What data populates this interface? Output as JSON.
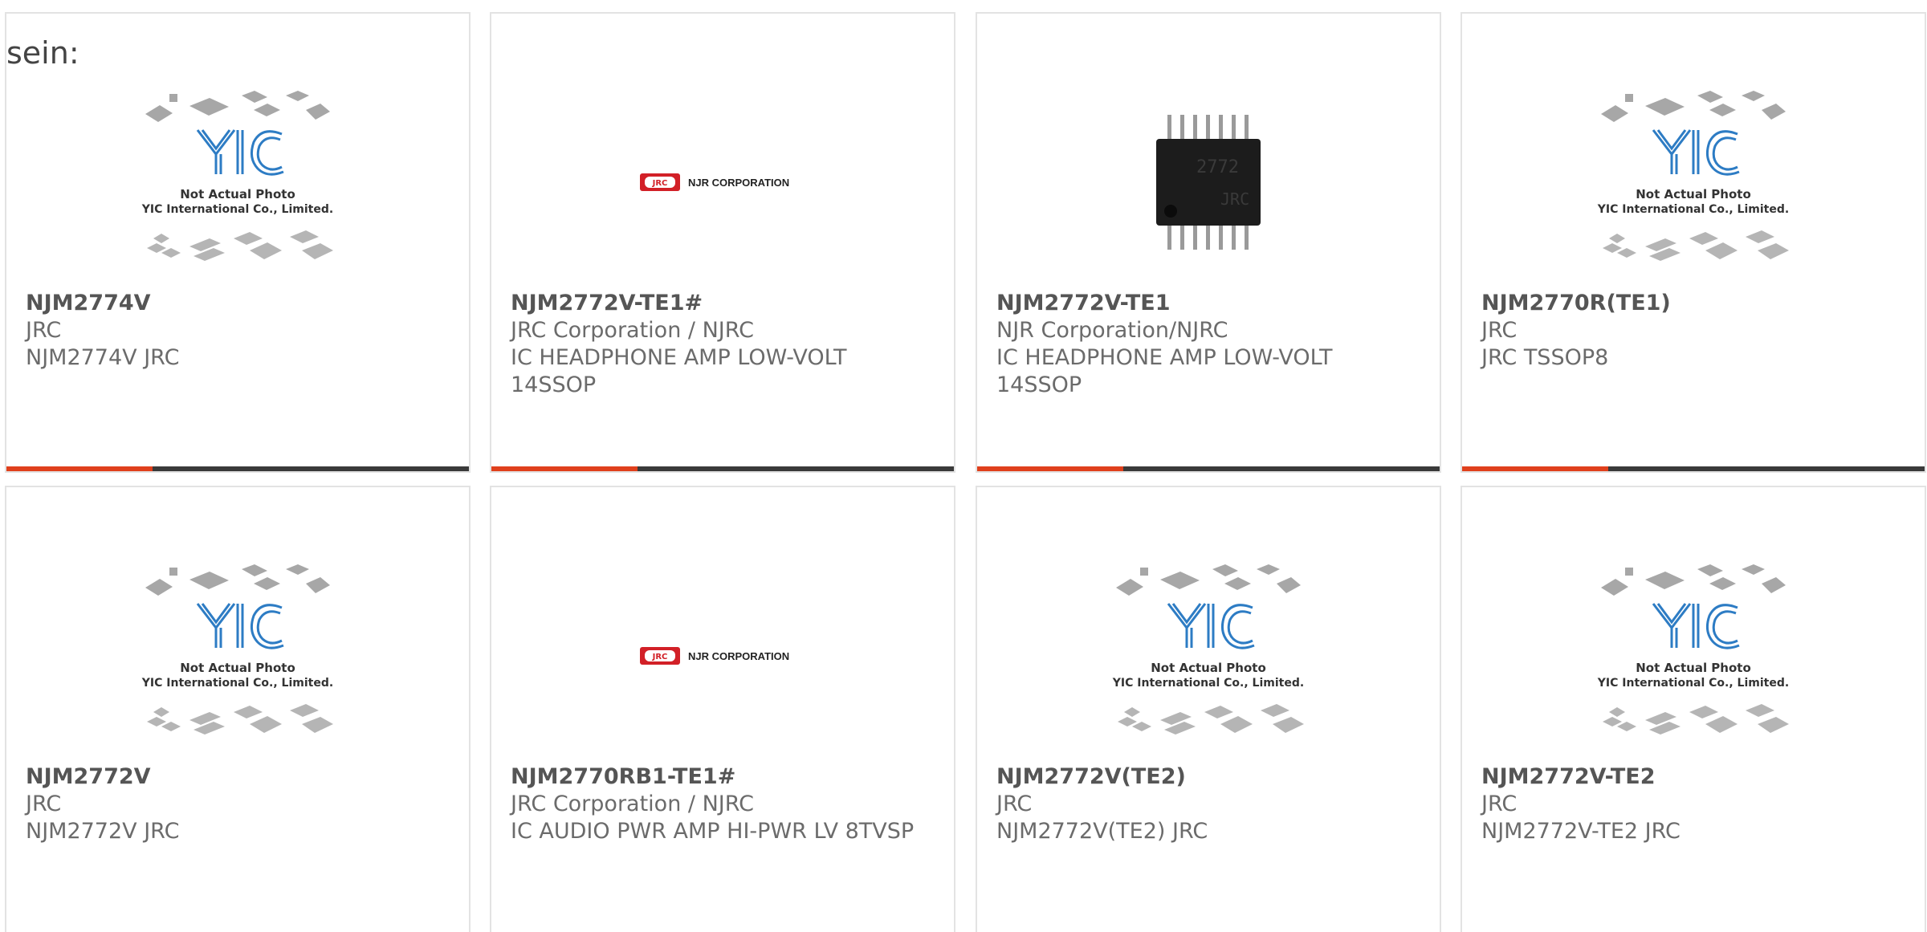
{
  "lead_text": "sein:",
  "colors": {
    "accent": "#e0401c",
    "bar_dark": "#3a3a3a",
    "yic_blue": "#2d7cc4",
    "jrc_red": "#d22027"
  },
  "placeholder": {
    "line1": "Not Actual Photo",
    "line2": "YIC International Co., Limited.",
    "brand": "YIC"
  },
  "njr_logo": {
    "badge": "JRC",
    "text": "NJR CORPORATION"
  },
  "chip_marking": {
    "top": "2772",
    "bottom": "JRC"
  },
  "products": [
    {
      "part_number": "NJM2774V",
      "manufacturer": "JRC",
      "description": "NJM2774V JRC",
      "image": "yic-placeholder"
    },
    {
      "part_number": "NJM2772V-TE1#",
      "manufacturer": "JRC Corporation / NJRC",
      "description": "IC HEADPHONE AMP LOW-VOLT 14SSOP",
      "image": "njr-logo"
    },
    {
      "part_number": "NJM2772V-TE1",
      "manufacturer": "NJR Corporation/NJRC",
      "description": "IC HEADPHONE AMP LOW-VOLT 14SSOP",
      "image": "chip-photo"
    },
    {
      "part_number": "NJM2770R(TE1)",
      "manufacturer": "JRC",
      "description": "JRC TSSOP8",
      "image": "yic-placeholder"
    },
    {
      "part_number": "NJM2772V",
      "manufacturer": "JRC",
      "description": "NJM2772V JRC",
      "image": "yic-placeholder"
    },
    {
      "part_number": "NJM2770RB1-TE1#",
      "manufacturer": "JRC Corporation / NJRC",
      "description": "IC AUDIO PWR AMP HI-PWR LV 8TVSP",
      "image": "njr-logo"
    },
    {
      "part_number": "NJM2772V(TE2)",
      "manufacturer": "JRC",
      "description": "NJM2772V(TE2) JRC",
      "image": "yic-placeholder"
    },
    {
      "part_number": "NJM2772V-TE2",
      "manufacturer": "JRC",
      "description": "NJM2772V-TE2 JRC",
      "image": "yic-placeholder"
    }
  ]
}
